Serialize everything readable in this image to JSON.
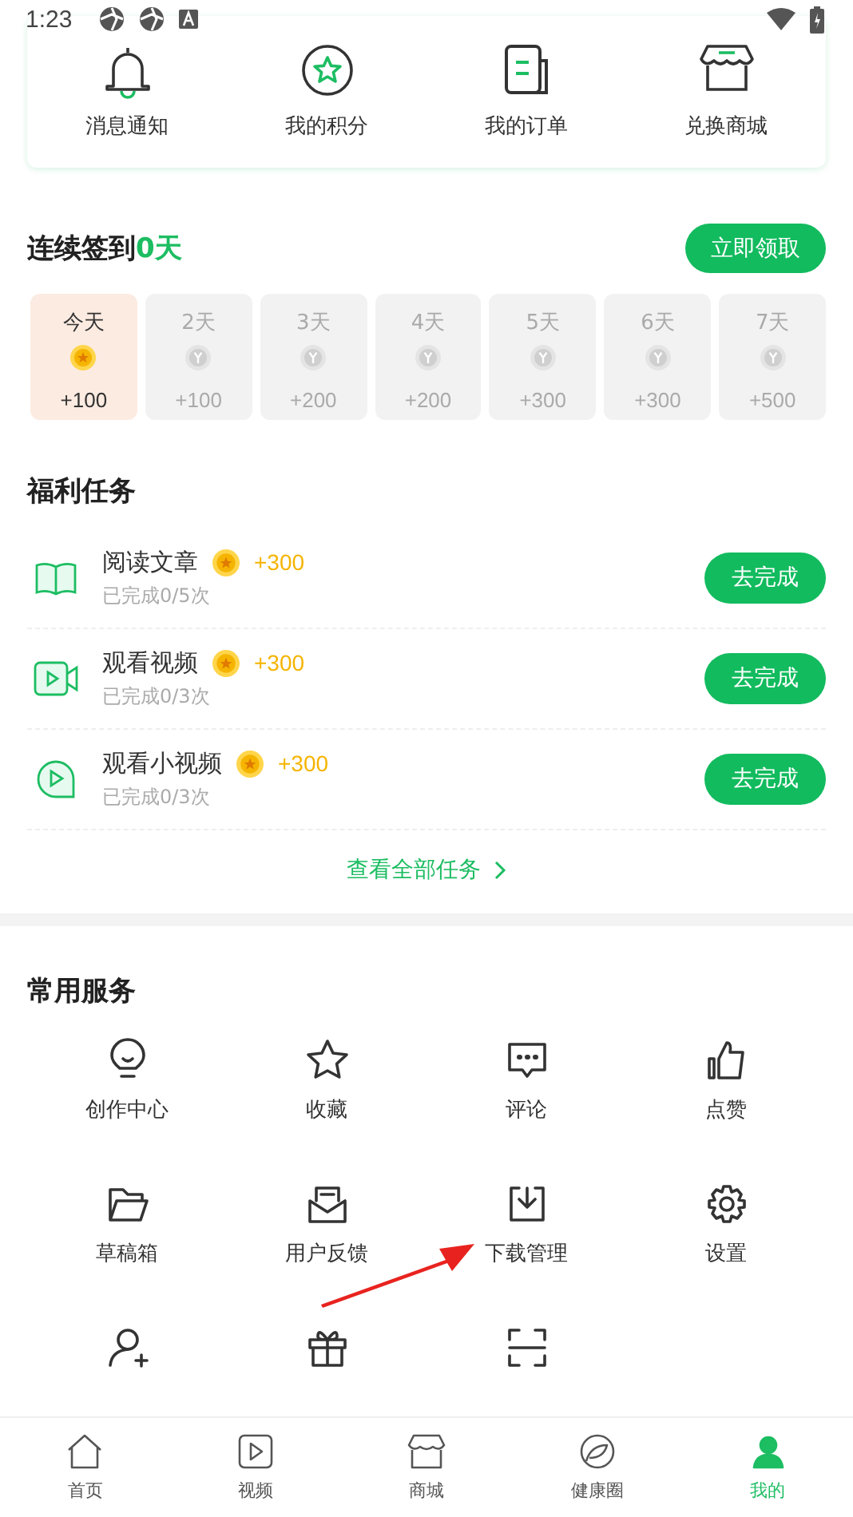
{
  "status_bar": {
    "time": "1:23"
  },
  "shortcuts": [
    {
      "label": "消息通知",
      "kind": "bell"
    },
    {
      "label": "我的积分",
      "kind": "points"
    },
    {
      "label": "我的订单",
      "kind": "orders"
    },
    {
      "label": "兑换商城",
      "kind": "shop"
    }
  ],
  "checkin": {
    "title": "连续签到",
    "streak": "0天",
    "button": "立即领取",
    "days": [
      {
        "label": "今天",
        "reward": "+100",
        "selected": true
      },
      {
        "label": "2天",
        "reward": "+100",
        "selected": false
      },
      {
        "label": "3天",
        "reward": "+200",
        "selected": false
      },
      {
        "label": "4天",
        "reward": "+200",
        "selected": false
      },
      {
        "label": "5天",
        "reward": "+300",
        "selected": false
      },
      {
        "label": "6天",
        "reward": "+300",
        "selected": false
      },
      {
        "label": "7天",
        "reward": "+500",
        "selected": false
      }
    ]
  },
  "tasks": {
    "title": "福利任务",
    "items": [
      {
        "kind": "article",
        "name": "阅读文章",
        "reward": "+300",
        "progress": "已完成0/5次",
        "button": "去完成"
      },
      {
        "kind": "video",
        "name": "观看视频",
        "reward": "+300",
        "progress": "已完成0/3次",
        "button": "去完成"
      },
      {
        "kind": "short_video",
        "name": "观看小视频",
        "reward": "+300",
        "progress": "已完成0/3次",
        "button": "去完成"
      }
    ],
    "more": "查看全部任务"
  },
  "services": {
    "title": "常用服务",
    "items": [
      {
        "kind": "bulb",
        "label": "创作中心"
      },
      {
        "kind": "star",
        "label": "收藏"
      },
      {
        "kind": "comment",
        "label": "评论"
      },
      {
        "kind": "like",
        "label": "点赞"
      },
      {
        "kind": "folder",
        "label": "草稿箱"
      },
      {
        "kind": "mail",
        "label": "用户反馈"
      },
      {
        "kind": "download",
        "label": "下载管理"
      },
      {
        "kind": "gear",
        "label": "设置"
      },
      {
        "kind": "add_user"
      },
      {
        "kind": "gift"
      },
      {
        "kind": "scan"
      }
    ]
  },
  "nav": [
    {
      "kind": "home",
      "label": "首页",
      "selected": false
    },
    {
      "kind": "video",
      "label": "视频",
      "selected": false
    },
    {
      "kind": "shop",
      "label": "商城",
      "selected": false
    },
    {
      "kind": "health",
      "label": "健康圈",
      "selected": false
    },
    {
      "kind": "me",
      "label": "我的",
      "selected": true
    }
  ]
}
